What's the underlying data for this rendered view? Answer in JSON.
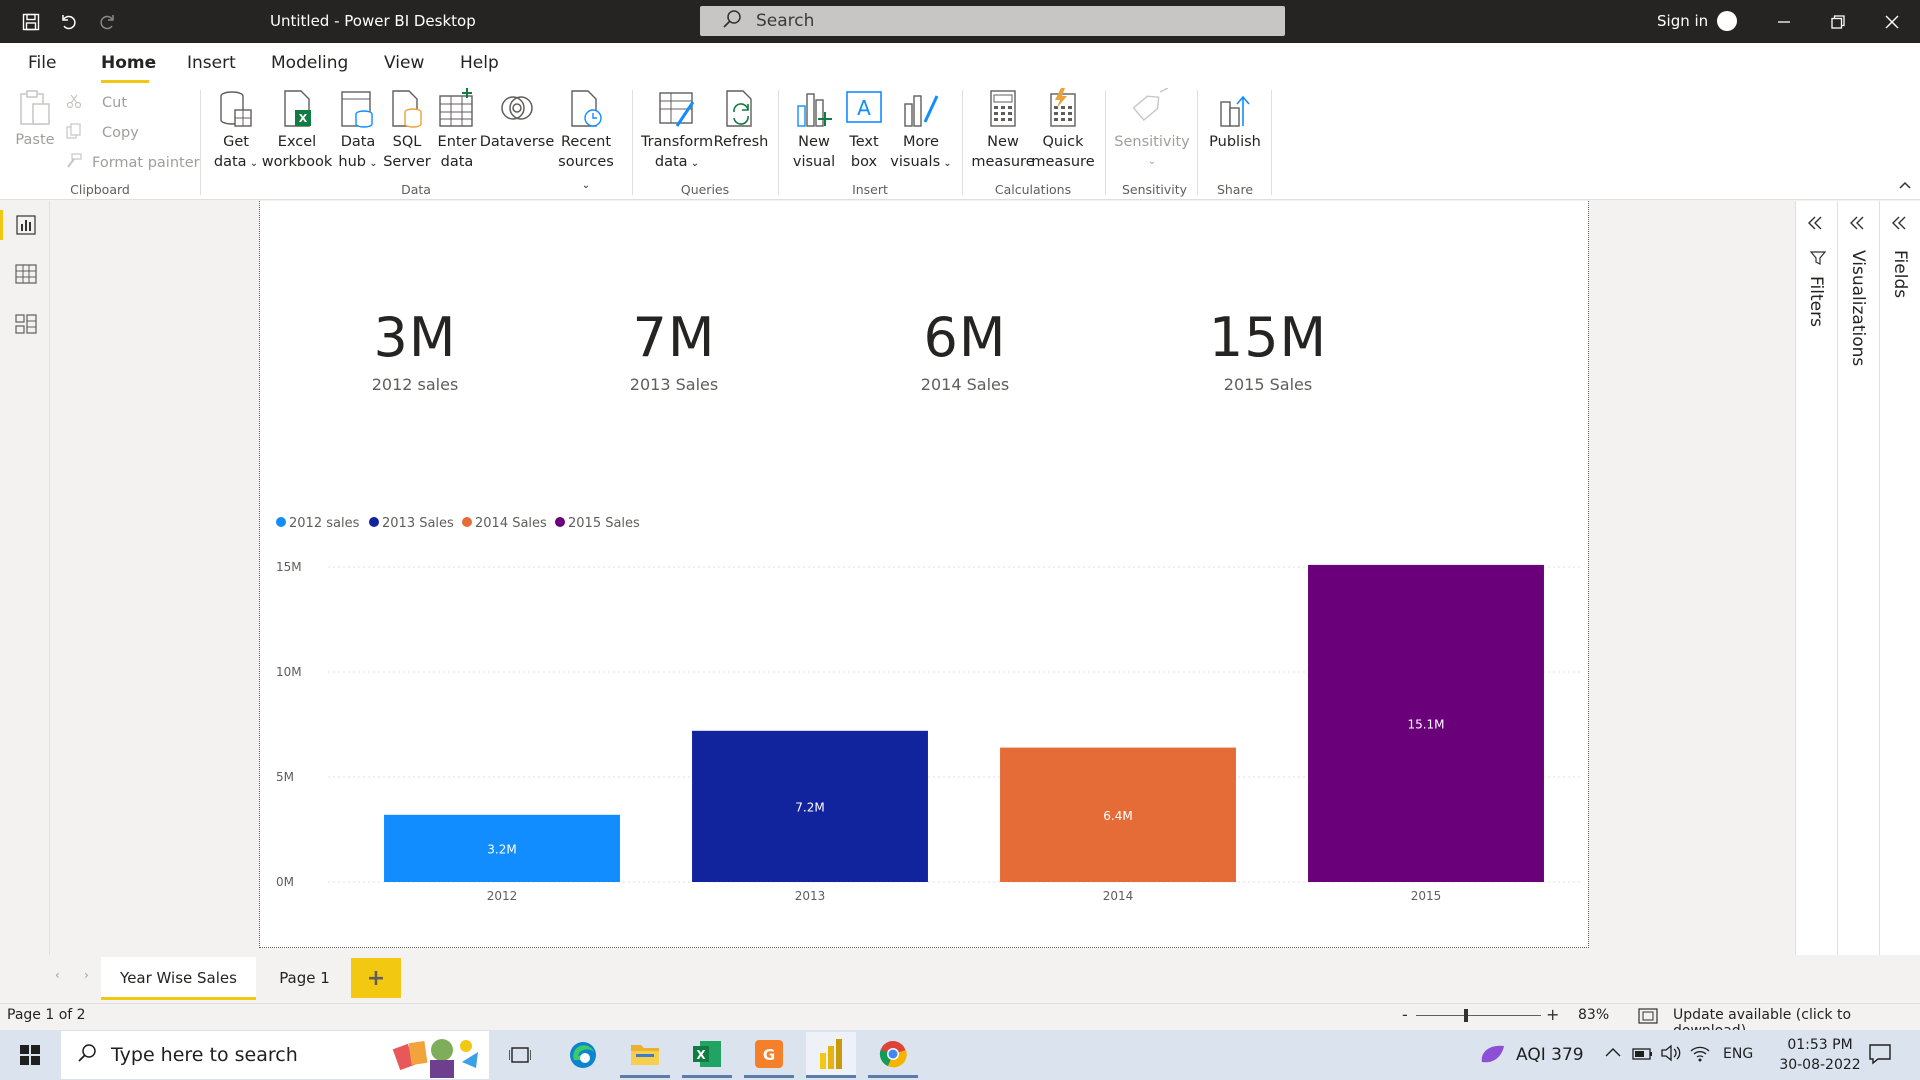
{
  "app": {
    "title": "Untitled - Power BI Desktop",
    "search_placeholder": "Search",
    "sign_in": "Sign in"
  },
  "menu": {
    "tabs": [
      "File",
      "Home",
      "Insert",
      "Modeling",
      "View",
      "Help"
    ],
    "active": "Home"
  },
  "ribbon": {
    "clipboard": {
      "paste": "Paste",
      "cut": "Cut",
      "copy": "Copy",
      "format_painter": "Format painter",
      "group_label": "Clipboard"
    },
    "data": {
      "get_data": [
        "Get",
        "data"
      ],
      "excel_workbook": [
        "Excel",
        "workbook"
      ],
      "data_hub": [
        "Data",
        "hub"
      ],
      "sql_server": [
        "SQL",
        "Server"
      ],
      "enter_data": [
        "Enter",
        "data"
      ],
      "dataverse": "Dataverse",
      "recent_sources": [
        "Recent",
        "sources"
      ],
      "group_label": "Data"
    },
    "queries": {
      "transform_data": [
        "Transform",
        "data"
      ],
      "refresh": "Refresh",
      "group_label": "Queries"
    },
    "insert": {
      "new_visual": [
        "New",
        "visual"
      ],
      "text_box": [
        "Text",
        "box"
      ],
      "more_visuals": [
        "More",
        "visuals"
      ],
      "group_label": "Insert"
    },
    "calculations": {
      "new_measure": [
        "New",
        "measure"
      ],
      "quick_measure": [
        "Quick",
        "measure"
      ],
      "group_label": "Calculations"
    },
    "sensitivity": {
      "label": "Sensitivity",
      "group_label": "Sensitivity"
    },
    "share": {
      "publish": "Publish",
      "group_label": "Share"
    }
  },
  "cards": [
    {
      "value": "3M",
      "label": "2012 sales"
    },
    {
      "value": "7M",
      "label": "2013 Sales"
    },
    {
      "value": "6M",
      "label": "2014 Sales"
    },
    {
      "value": "15M",
      "label": "2015 Sales"
    }
  ],
  "chart_data": {
    "type": "bar",
    "categories": [
      "2012",
      "2013",
      "2014",
      "2015"
    ],
    "series": [
      {
        "name": "2012 sales",
        "color": "#118dff",
        "values": [
          3.2,
          null,
          null,
          null
        ],
        "data_labels": [
          "3.2M",
          null,
          null,
          null
        ]
      },
      {
        "name": "2013 Sales",
        "color": "#12239e",
        "values": [
          null,
          7.2,
          null,
          null
        ],
        "data_labels": [
          null,
          "7.2M",
          null,
          null
        ]
      },
      {
        "name": "2014 Sales",
        "color": "#e66c37",
        "values": [
          null,
          null,
          6.4,
          null
        ],
        "data_labels": [
          null,
          null,
          "6.4M",
          null
        ]
      },
      {
        "name": "2015 Sales",
        "color": "#6b007b",
        "values": [
          null,
          null,
          null,
          15.1
        ],
        "data_labels": [
          null,
          null,
          null,
          "15.1M"
        ]
      }
    ],
    "yticks": [
      0,
      5,
      10,
      15
    ],
    "ytick_labels": [
      "0M",
      "5M",
      "10M",
      "15M"
    ],
    "ylim": [
      0,
      15
    ],
    "legend": "top-left",
    "grid": true,
    "title": "",
    "xlabel": "",
    "ylabel": ""
  },
  "right_panes": {
    "filters": "Filters",
    "visualizations": "Visualizations",
    "fields": "Fields"
  },
  "pages": {
    "tabs": [
      "Year Wise Sales",
      "Page 1"
    ],
    "active": "Year Wise Sales",
    "add_label": "+"
  },
  "status": {
    "page_indicator": "Page 1 of 2",
    "zoom_minus": "-",
    "zoom_plus": "+",
    "zoom": "83%",
    "update": "Update available (click to download)"
  },
  "taskbar": {
    "search_placeholder": "Type here to search",
    "aqi": "AQI 379",
    "language": "ENG",
    "time": "01:53 PM",
    "date": "30-08-2022"
  },
  "colors": {
    "accent": "#f2c811",
    "titlebar": "#252423"
  }
}
